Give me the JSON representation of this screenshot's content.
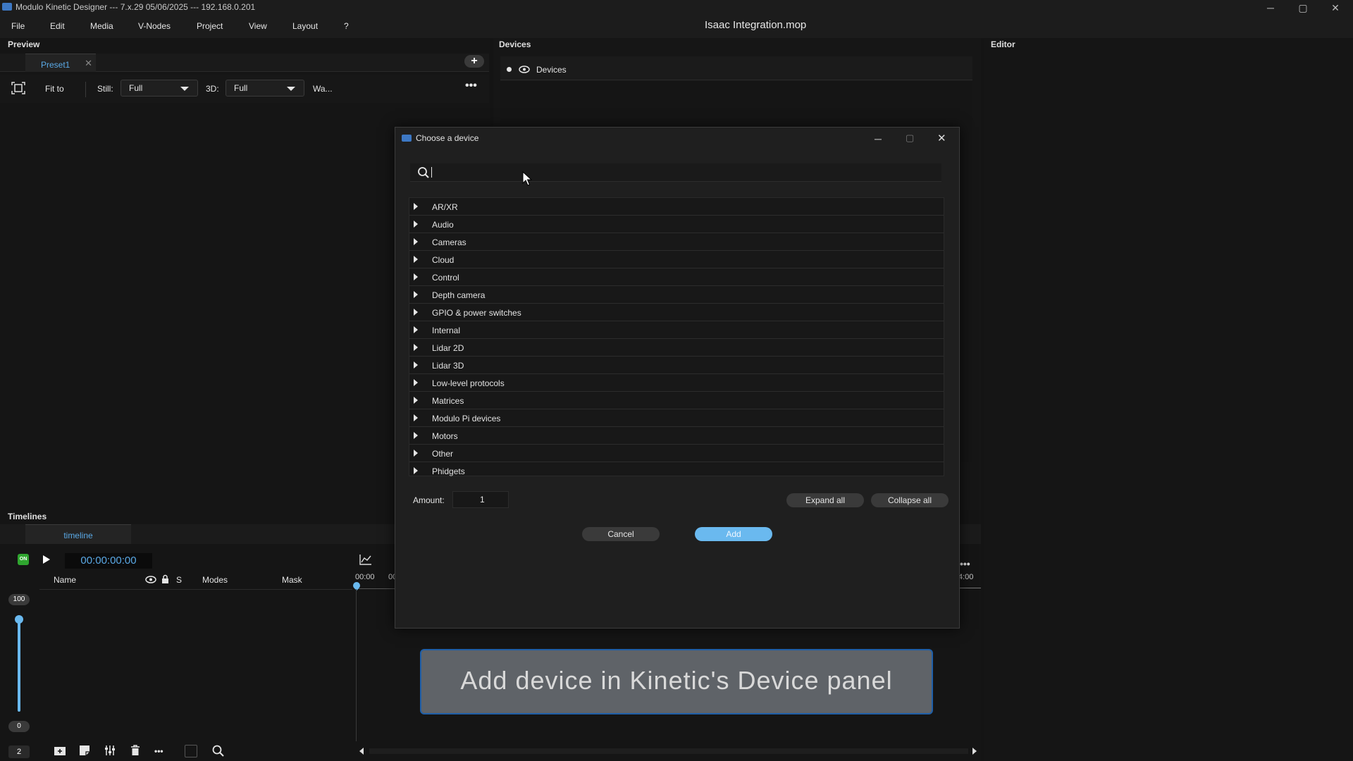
{
  "window": {
    "title": "Modulo Kinetic Designer --- 7.x.29 05/06/2025 --- 192.168.0.201",
    "project_title": "Isaac Integration.mop",
    "controls": {
      "minimize": "─",
      "maximize": "▢",
      "close": "✕"
    }
  },
  "menu": [
    "File",
    "Edit",
    "Media",
    "V-Nodes",
    "Project",
    "View",
    "Layout",
    "?"
  ],
  "preview": {
    "header": "Preview",
    "tab": "Preset1",
    "fit_label": "Fit to",
    "still_label": "Still:",
    "still_value": "Full",
    "threed_label": "3D:",
    "threed_value": "Full",
    "warp_label": "Wa..."
  },
  "devices": {
    "header": "Devices",
    "tree_root": "Devices"
  },
  "editor": {
    "header": "Editor"
  },
  "timelines": {
    "header": "Timelines",
    "tab": "timeline",
    "on_badge": "ON",
    "timecode": "00:00:00:00",
    "columns": {
      "name": "Name",
      "solo": "S",
      "modes": "Modes",
      "mask": "Mask"
    },
    "ruler": {
      "start": "00:00",
      "partial": "00",
      "end": "4:00"
    },
    "volume_max": "100",
    "volume_min": "0",
    "volume_level": 1.0,
    "track_count": "2"
  },
  "dialog": {
    "title": "Choose a device",
    "search_value": "",
    "categories": [
      "AR/XR",
      "Audio",
      "Cameras",
      "Cloud",
      "Control",
      "Depth camera",
      "GPIO & power switches",
      "Internal",
      "Lidar 2D",
      "Lidar 3D",
      "Low-level protocols",
      "Matrices",
      "Modulo Pi devices",
      "Motors",
      "Other",
      "Phidgets"
    ],
    "amount_label": "Amount:",
    "amount_value": "1",
    "expand_all": "Expand all",
    "collapse_all": "Collapse all",
    "cancel": "Cancel",
    "add": "Add"
  },
  "banner": {
    "text": "Add device in Kinetic's Device panel"
  },
  "colors": {
    "accent": "#5aa9e6",
    "add_button": "#6ab9ef",
    "banner_bg": "#5f6368",
    "banner_border": "#1f5fa8"
  }
}
